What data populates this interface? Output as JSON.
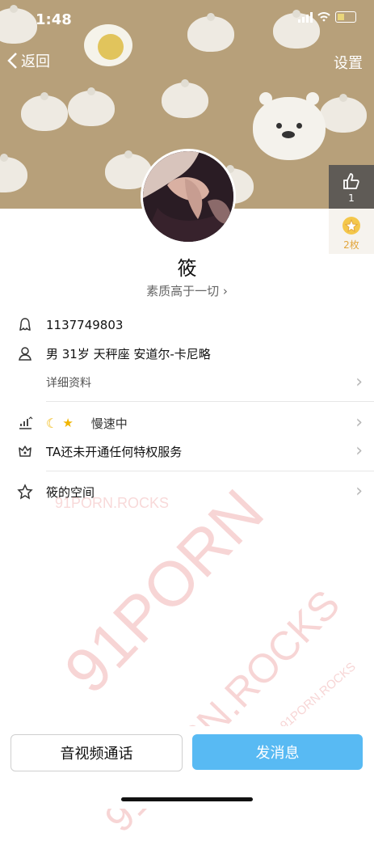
{
  "status_bar": {
    "time": "1:48"
  },
  "nav": {
    "back_label": "返回",
    "settings_label": "设置"
  },
  "profile": {
    "name": "筱",
    "signature": "素质高于一切",
    "like_count": "1",
    "coins": "2枚"
  },
  "info": {
    "qq": "1137749803",
    "basic": "男 31岁 天秤座 安道尔-卡尼略",
    "details_label": "详细资料",
    "level_text": "慢速中",
    "privilege_text": "TA还未开通任何特权服务",
    "space_label": "筱的空间"
  },
  "actions": {
    "call_label": "音视频通话",
    "message_label": "发消息"
  },
  "watermarks": {
    "w1": "91PORN.ROCKS",
    "w2": "91PORN",
    "w3": "91PORN.ROCKS",
    "w4": "91PORN.ROCKS 91PORN.ROCKS"
  },
  "colors": {
    "header_bg": "#b7a07a",
    "accent_blue": "#58baf3",
    "coin": "#e3a63c",
    "watermark": "#de5050"
  }
}
